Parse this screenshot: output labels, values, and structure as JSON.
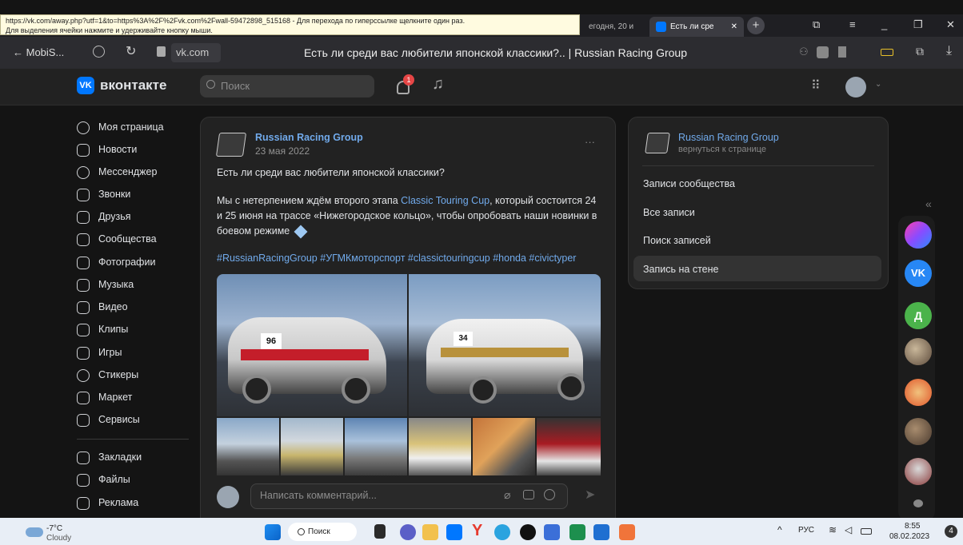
{
  "tooltip": {
    "line1": "https://vk.com/away.php?utf=1&to=https%3A%2F%2Fvk.com%2Fwall-59472898_515168 - Для перехода по гиперссылке щелкните один раз.",
    "line2": "Для выделения ячейки нажмите и удерживайте кнопку мыши."
  },
  "tabs": [
    {
      "label": "егодня, 20 и"
    },
    {
      "label": "Есть ли сре"
    }
  ],
  "addressbar": {
    "back_label": "← MobiS...",
    "url": "vk.com",
    "page_title": "Есть ли среди вас любители японской классики?.. | Russian Racing Group"
  },
  "vk": {
    "logo_text": "вконтакте",
    "logo_mark": "VK",
    "search_placeholder": "Поиск",
    "notif_count": "1"
  },
  "nav": {
    "items": [
      {
        "label": "Моя страница"
      },
      {
        "label": "Новости"
      },
      {
        "label": "Мессенджер"
      },
      {
        "label": "Звонки"
      },
      {
        "label": "Друзья"
      },
      {
        "label": "Сообщества"
      },
      {
        "label": "Фотографии"
      },
      {
        "label": "Музыка"
      },
      {
        "label": "Видео"
      },
      {
        "label": "Клипы"
      },
      {
        "label": "Игры"
      },
      {
        "label": "Стикеры"
      },
      {
        "label": "Маркет"
      },
      {
        "label": "Сервисы"
      }
    ],
    "items2": [
      {
        "label": "Закладки"
      },
      {
        "label": "Файлы"
      },
      {
        "label": "Реклама"
      }
    ]
  },
  "post": {
    "author": "Russian Racing Group",
    "date": "23 мая 2022",
    "more": "···",
    "line1": "Есть ли среди вас любители японской классики?",
    "p2_pre": "Мы с нетерпением ждём второго этапа ",
    "p2_link": "Classic Touring Cup",
    "p2_post": ", который состоится 24 и 25 июня на трассе «Нижегородское кольцо», чтобы опробовать наши новинки в боевом режиме",
    "hashtags": "#RussianRacingGroup #УГМКмоторспорт #classictouringcup #honda #civictyper",
    "car1_number": "96",
    "car2_number": "34",
    "comment_placeholder": "Написать комментарий..."
  },
  "rpanel": {
    "name": "Russian Racing Group",
    "back": "вернуться к странице",
    "menu": [
      {
        "label": "Записи сообщества"
      },
      {
        "label": "Все записи"
      },
      {
        "label": "Поиск записей"
      },
      {
        "label": "Запись на стене"
      }
    ]
  },
  "dock": {
    "collapse": "«",
    "d_label": "Д"
  },
  "taskbar": {
    "temp": "-7°C",
    "weather": "Cloudy",
    "search_label": "Поиск",
    "lang": "РУС",
    "time": "8:55",
    "date": "08.02.2023",
    "notif": "4"
  },
  "colors": {
    "accent": "#0077ff",
    "link": "#71aaeb",
    "page_bg": "#141414",
    "card_bg": "#222222"
  }
}
